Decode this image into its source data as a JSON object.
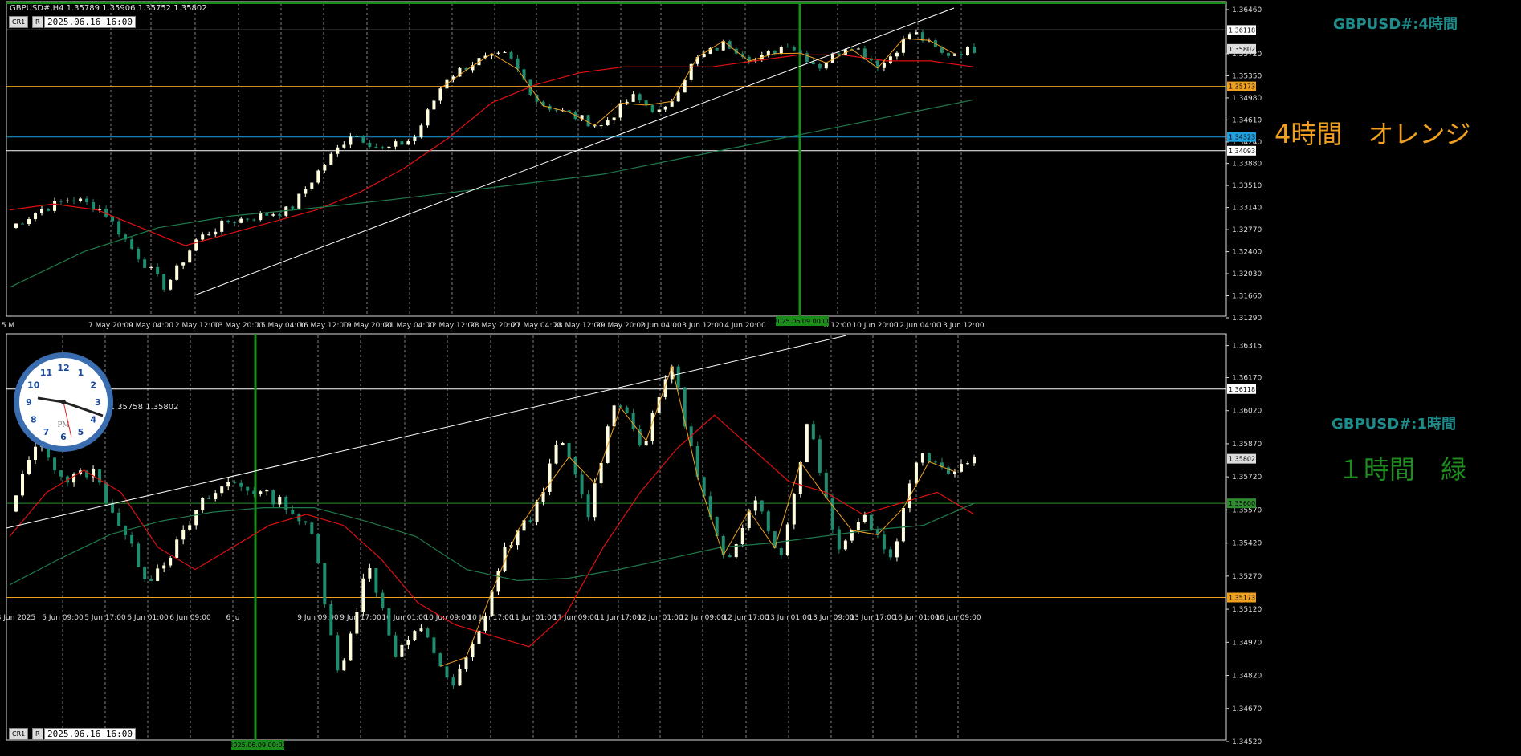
{
  "colors": {
    "background": "#000000",
    "grid": "#a0a0a0",
    "candle_bull": "#ffffe0",
    "candle_bear": "#1e8c6e",
    "ma_red": "#e01010",
    "ma_green": "#1f7a4a",
    "zigzag": "#f0a020",
    "orange_level": "#f0a020",
    "green_level": "#2e8b2e",
    "blue_level": "#1fa0e0",
    "white_level": "#ffffff",
    "trendline": "#ffffff",
    "vline": "#1a8c1a",
    "title": "#1f8c8c",
    "note_orange": "#f0a020",
    "note_green": "#1f8c1f"
  },
  "top": {
    "info": "GBPUSD#,H4  1.35789 1.35906 1.35752 1.35802",
    "btn_cr": "CR1",
    "btn_r": "R",
    "date_box": "2025.06.16 16:00",
    "title": "GBPUSD#:4時間",
    "note": "4時間　オレンジ",
    "vline_label": "2025.06.09 00:00",
    "x_labels": [
      "5 M",
      "7 May 20:00",
      "9 May 04:00",
      "12 May 12:00",
      "13 May 20:00",
      "15 May 04:00",
      "16 May 12:00",
      "19 May 20:00",
      "21 May 04:00",
      "22 May 12:00",
      "23 May 20:00",
      "27 May 04:00",
      "28 May 12:00",
      "29 May 20:00",
      "2 Jun 04:00",
      "3 Jun 12:00",
      "4 Jun 20:00",
      "n 12:00",
      "10 Jun 20:00",
      "12 Jun 04:00",
      "13 Jun 12:00"
    ],
    "y_labels": [
      "1.36460",
      "1.35720",
      "1.35350",
      "1.34980",
      "1.34610",
      "1.34240",
      "1.33880",
      "1.33510",
      "1.33140",
      "1.32770",
      "1.32400",
      "1.32030",
      "1.31660",
      "1.31290"
    ],
    "level_labels": {
      "white_high": "1.36118",
      "price": "1.35802",
      "orange": "1.35173",
      "blue": "1.34323",
      "white_low": "1.34093"
    }
  },
  "bottom": {
    "info": "5831 1.35758 1.35802",
    "btn_cr": "CR1",
    "btn_r": "R",
    "date_box": "2025.06.16 16:00",
    "title": "GBPUSD#:1時間",
    "note": "１時間　緑",
    "vline_label": "2025.06.09 00:00",
    "x_labels": [
      "3 Jun 2025",
      "5 Jun 09:00",
      "5 Jun 17:00",
      "6 Jun 01:00",
      "6 Jun 09:00",
      "6 Ju",
      "9 Jun 09:00",
      "9 Jun 17:00",
      "10 Jun 01:00",
      "10 Jun 09:00",
      "10 Jun 17:00",
      "11 Jun 01:00",
      "11 Jun 09:00",
      "11 Jun 17:00",
      "12 Jun 01:00",
      "12 Jun 09:00",
      "12 Jun 17:00",
      "13 Jun 01:00",
      "13 Jun 09:00",
      "13 Jun 17:00",
      "16 Jun 01:00",
      "16 Jun 09:00"
    ],
    "y_labels": [
      "1.36315",
      "1.36170",
      "1.36020",
      "1.35870",
      "1.35720",
      "1.35570",
      "1.35420",
      "1.35270",
      "1.35120",
      "1.34970",
      "1.34820",
      "1.34670",
      "1.34520"
    ],
    "level_labels": {
      "white_high": "1.36118",
      "price": "1.35802",
      "green": "1.35600",
      "orange": "1.35173"
    }
  },
  "clock": {
    "numbers": [
      "12",
      "1",
      "2",
      "3",
      "4",
      "5",
      "6",
      "7",
      "8",
      "9",
      "10",
      "11"
    ],
    "ampm": "PM"
  },
  "chart_data": [
    {
      "type": "candlestick",
      "title": "GBPUSD#:4時間",
      "symbol": "GBPUSD#",
      "timeframe": "H4",
      "ylim": [
        1.3129,
        1.3646
      ],
      "last": {
        "open": 1.35789,
        "high": 1.35906,
        "low": 1.35752,
        "close": 1.35802
      },
      "x": [
        "5 M",
        "7 May 20:00",
        "9 May 04:00",
        "12 May 12:00",
        "13 May 20:00",
        "15 May 04:00",
        "16 May 12:00",
        "19 May 20:00",
        "21 May 04:00",
        "22 May 12:00",
        "23 May 20:00",
        "27 May 04:00",
        "28 May 12:00",
        "29 May 20:00",
        "2 Jun 04:00",
        "3 Jun 12:00",
        "4 Jun 20:00",
        "n 12:00",
        "10 Jun 20:00",
        "12 Jun 04:00",
        "13 Jun 12:00"
      ],
      "series": [
        {
          "values": [
            1.328,
            1.331,
            1.333,
            1.331,
            1.324,
            1.318,
            1.326,
            1.329,
            1.33,
            1.331,
            1.338,
            1.344,
            1.341,
            1.343,
            1.353,
            1.356,
            1.357,
            1.349,
            1.347,
            1.345,
            1.35,
            1.347,
            1.356,
            1.359,
            1.356,
            1.359,
            1.355,
            1.359,
            1.355,
            1.361,
            1.357,
            1.358
          ]
        },
        {
          "name": "",
          "values": [
            1.331,
            1.332,
            1.331,
            1.328,
            1.325,
            1.327,
            1.329,
            1.331,
            1.334,
            1.338,
            1.343,
            1.349,
            1.352,
            1.354,
            1.355,
            1.355,
            1.355,
            1.356,
            1.357,
            1.357,
            1.356,
            1.356,
            1.355
          ]
        },
        {
          "name": "",
          "values": [
            1.318,
            1.324,
            1.328,
            1.33,
            1.3312,
            1.3325,
            1.334,
            1.3355,
            1.337,
            1.3395,
            1.342,
            1.3445,
            1.347,
            1.3495
          ]
        }
      ],
      "levels": {
        "white_high": 1.36118,
        "price": 1.35802,
        "orange": 1.35173,
        "blue": 1.34323,
        "white_low": 1.34093
      },
      "vertical_marker": "2025.06.09 00:00"
    },
    {
      "type": "candlestick",
      "title": "GBPUSD#:1時間",
      "symbol": "GBPUSD#",
      "timeframe": "H1",
      "ylim": [
        1.3452,
        1.3631
      ],
      "x": [
        "3 Jun 2025",
        "5 Jun 09:00",
        "5 Jun 17:00",
        "6 Jun 01:00",
        "6 Jun 09:00",
        "6 Ju",
        "9 Jun 09:00",
        "9 Jun 17:00",
        "10 Jun 01:00",
        "10 Jun 09:00",
        "10 Jun 17:00",
        "11 Jun 01:00",
        "11 Jun 09:00",
        "11 Jun 17:00",
        "12 Jun 01:00",
        "12 Jun 09:00",
        "12 Jun 17:00",
        "13 Jun 01:00",
        "13 Jun 09:00",
        "13 Jun 17:00",
        "16 Jun 01:00",
        "16 Jun 09:00"
      ],
      "series": [
        {
          "values": [
            1.3555,
            1.359,
            1.357,
            1.3575,
            1.355,
            1.3525,
            1.354,
            1.356,
            1.357,
            1.3565,
            1.356,
            1.3545,
            1.348,
            1.3535,
            1.349,
            1.3505,
            1.3475,
            1.35,
            1.354,
            1.3555,
            1.359,
            1.3555,
            1.361,
            1.3585,
            1.3625,
            1.357,
            1.353,
            1.3565,
            1.3535,
            1.36,
            1.354,
            1.3555,
            1.3535,
            1.3585,
            1.3575,
            1.358
          ]
        },
        {
          "name": "",
          "values": [
            1.3545,
            1.3565,
            1.3575,
            1.3565,
            1.354,
            1.353,
            1.354,
            1.355,
            1.3555,
            1.355,
            1.3535,
            1.3515,
            1.3505,
            1.35,
            1.3495,
            1.351,
            1.354,
            1.3565,
            1.3585,
            1.36,
            1.3585,
            1.357,
            1.3565,
            1.3555,
            1.356,
            1.3565,
            1.3555
          ]
        },
        {
          "name": "",
          "values": [
            1.3523,
            1.3535,
            1.3546,
            1.3552,
            1.3556,
            1.3558,
            1.3558,
            1.3552,
            1.3545,
            1.353,
            1.3525,
            1.3526,
            1.353,
            1.3535,
            1.354,
            1.3542,
            1.3545,
            1.3548,
            1.355,
            1.356
          ]
        }
      ],
      "levels": {
        "white_high": 1.36118,
        "price": 1.35802,
        "green": 1.356,
        "orange": 1.35173
      },
      "vertical_marker": "2025.06.09 00:00"
    }
  ]
}
